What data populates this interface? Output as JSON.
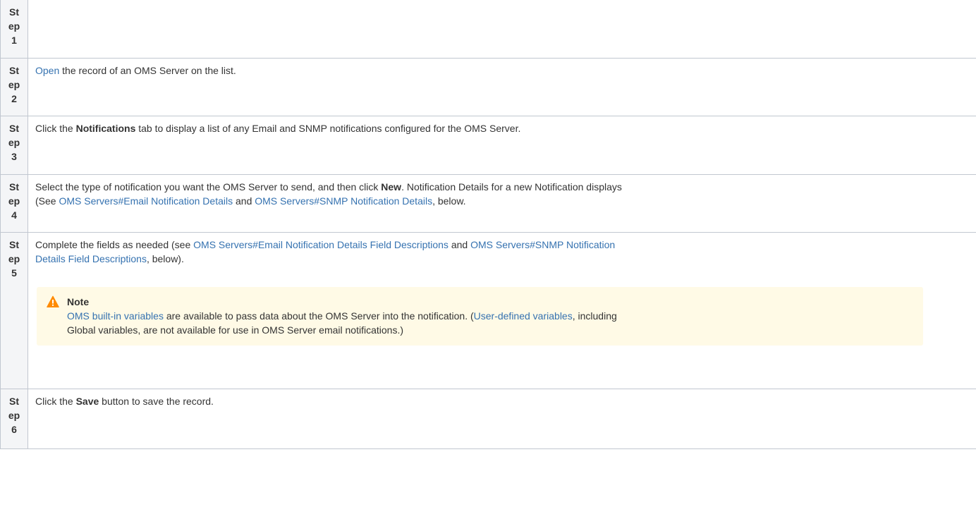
{
  "steps": [
    {
      "head": [
        "St",
        "ep",
        "1"
      ]
    },
    {
      "head": [
        "St",
        "ep",
        "2"
      ],
      "link": "Open",
      "text": " the record of an OMS Server on the list."
    },
    {
      "head": [
        "St",
        "ep",
        "3"
      ],
      "pre": "Click the ",
      "bold": "Notifications",
      "post": " tab to display a list of any Email and SNMP notifications configured for the OMS Server."
    },
    {
      "head": [
        "St",
        "ep",
        "4"
      ],
      "line1_pre": "Select the type of notification you want the OMS Server to send, and then click ",
      "line1_bold": "New",
      "line1_post": ". Notification Details for a new Notification displays",
      "line2_pre": "(See ",
      "link1": "OMS Servers#Email Notification Details",
      "mid": " and ",
      "link2": "OMS Servers#SNMP Notification Details",
      "post": ", below."
    },
    {
      "head": [
        "St",
        "ep",
        "5"
      ],
      "pre": "Complete the fields as needed (see ",
      "link1": "OMS Servers#Email Notification Details Field Descriptions",
      "mid": " and ",
      "link2a": "OMS Servers#SNMP Notification",
      "link2b": "Details Field Descriptions",
      "post": ", below).",
      "note": {
        "title": "Note",
        "link1": "OMS built-in variables",
        "text1": " are available to pass data about the OMS Server into the notification. (",
        "link2": "User-defined variables",
        "text2": ", including",
        "text3": "Global variables, are not available for use in OMS Server email notifications.)",
        "icon": "warning-icon"
      }
    },
    {
      "head": [
        "St",
        "ep",
        "6"
      ],
      "pre": "Click the ",
      "bold": "Save",
      "post": " button to save the record."
    }
  ],
  "colors": {
    "link": "#3572b0",
    "note_bg": "#fffae6",
    "warning": "#ff8b00",
    "header_bg": "#f4f5f7",
    "border": "#c1c7d0"
  }
}
